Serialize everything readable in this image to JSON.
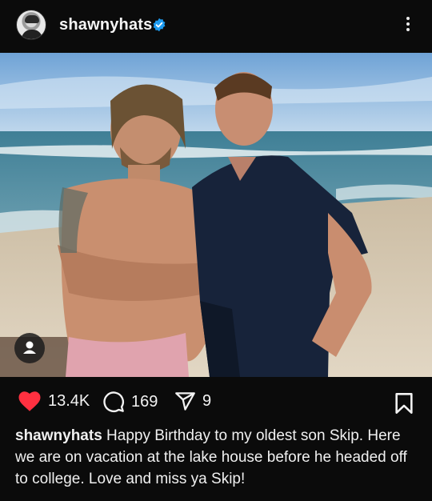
{
  "post": {
    "username": "shawnyhats",
    "verified": true,
    "likes": "13.4K",
    "comments": "169",
    "shares": "9",
    "caption_user": "shawnyhats",
    "caption_text": "Happy Birthday to my oldest son Skip. Here we are on vacation at the lake house before he headed off to college. Love and miss ya Skip!"
  },
  "icons": {
    "verified": "verified-badge-icon",
    "more": "more-vertical-icon",
    "like": "heart-icon",
    "comment": "comment-icon",
    "share": "send-icon",
    "save": "bookmark-icon",
    "tag": "user-tag-icon"
  },
  "colors": {
    "background": "#0b0b0b",
    "heart": "#ff3040",
    "verified": "#1d9bf0",
    "text": "#f2f2f2"
  }
}
